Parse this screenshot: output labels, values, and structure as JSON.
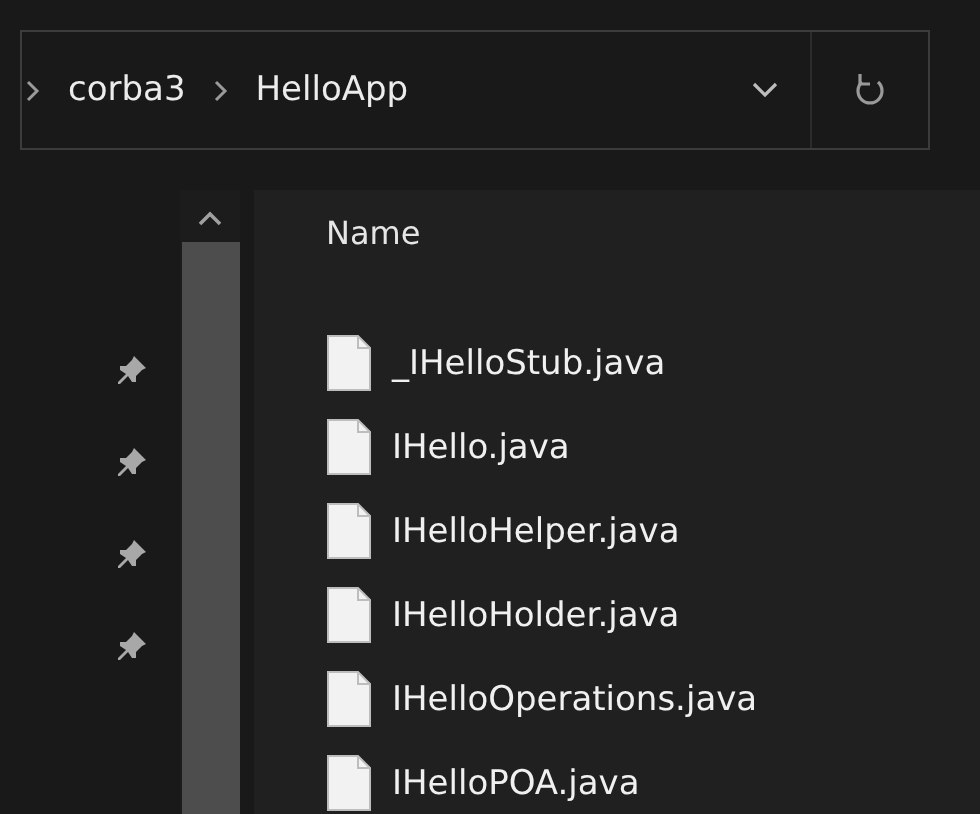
{
  "address_bar": {
    "breadcrumbs": [
      "corba3",
      "HelloApp"
    ]
  },
  "file_list": {
    "column_header": "Name",
    "files": [
      {
        "name": "_IHelloStub.java"
      },
      {
        "name": "IHello.java"
      },
      {
        "name": "IHelloHelper.java"
      },
      {
        "name": "IHelloHolder.java"
      },
      {
        "name": "IHelloOperations.java"
      },
      {
        "name": "IHelloPOA.java"
      }
    ]
  }
}
